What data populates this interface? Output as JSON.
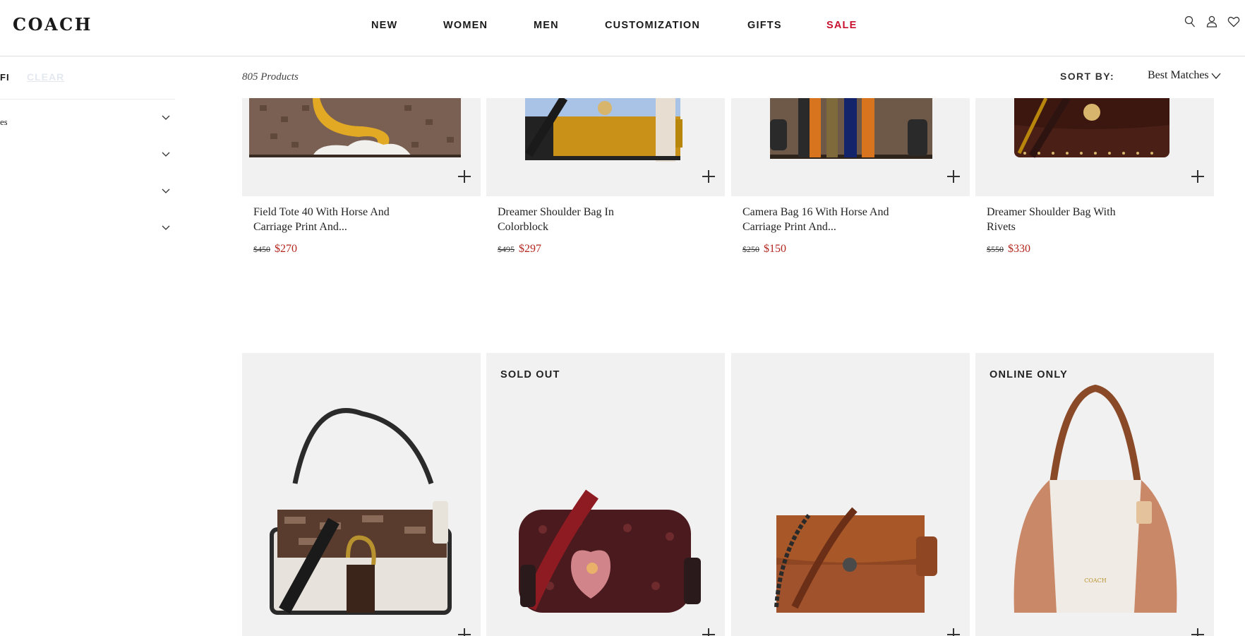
{
  "brand": {
    "logo": "COACH"
  },
  "nav": {
    "items": [
      "NEW",
      "WOMEN",
      "MEN",
      "CUSTOMIZATION",
      "GIFTS",
      "SALE"
    ]
  },
  "header_icons": [
    "search-icon",
    "account-icon",
    "wishlist-icon"
  ],
  "sidebar": {
    "filters_label": "FILTERS",
    "clear_label": "CLEAR",
    "filters": [
      {
        "label": "es"
      },
      {
        "label": ""
      },
      {
        "label": ""
      },
      {
        "label": ""
      }
    ]
  },
  "results": {
    "count": "805 Products",
    "sort_label": "SORT BY:",
    "sort_value": "Best Matches"
  },
  "products_row1": [
    {
      "name": "Field Tote 40 With Horse And Carriage Print And...",
      "old_price": "$450",
      "price": "$270"
    },
    {
      "name": "Dreamer Shoulder Bag In Colorblock",
      "old_price": "$495",
      "price": "$297"
    },
    {
      "name": "Camera Bag 16 With Horse And Carriage Print And...",
      "old_price": "$250",
      "price": "$150"
    },
    {
      "name": "Dreamer Shoulder Bag With Rivets",
      "old_price": "$550",
      "price": "$330"
    }
  ],
  "products_row2": [
    {
      "badge": ""
    },
    {
      "badge": "SOLD OUT"
    },
    {
      "badge": ""
    },
    {
      "badge": "ONLINE ONLY"
    }
  ],
  "colors": {
    "sale": "#c8102e",
    "price": "#b3261e",
    "tile_bg": "#f1f1f1"
  }
}
